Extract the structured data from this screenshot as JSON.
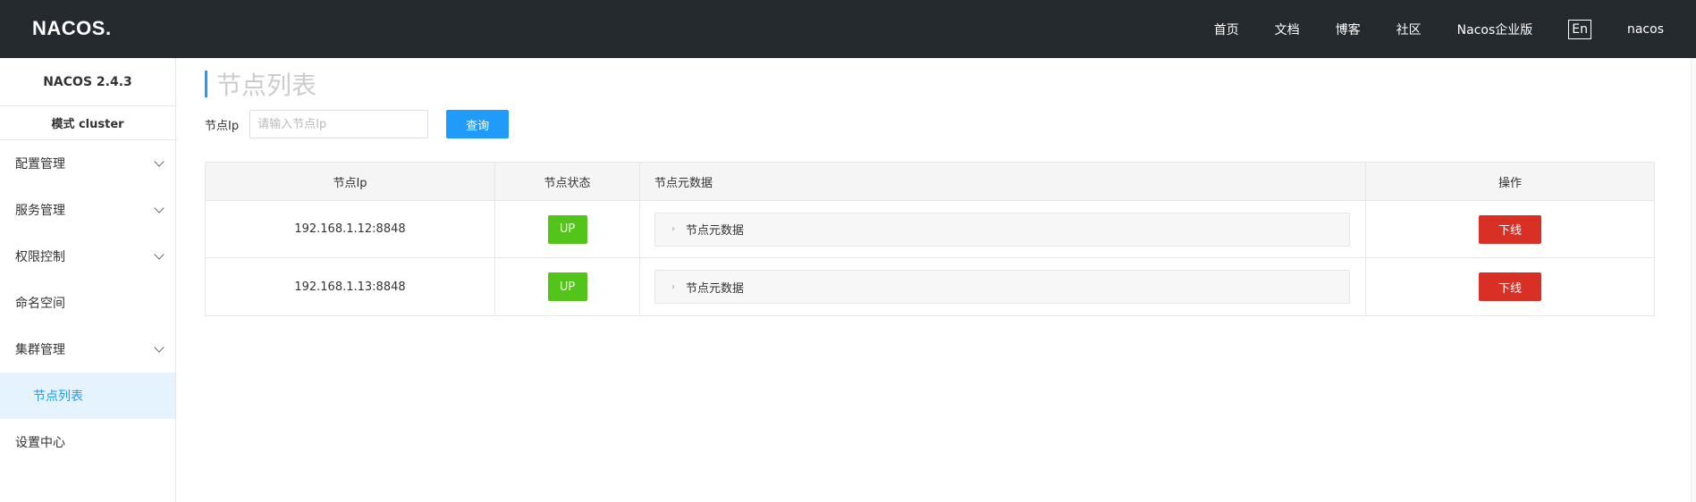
{
  "header": {
    "logo_text": "NACOS",
    "logo_dot": ".",
    "nav": [
      "首页",
      "文档",
      "博客",
      "社区",
      "Nacos企业版"
    ],
    "lang": "En",
    "user": "nacos"
  },
  "sidebar": {
    "version": "NACOS 2.4.3",
    "mode": "模式 cluster",
    "items": [
      {
        "label": "配置管理"
      },
      {
        "label": "服务管理"
      },
      {
        "label": "权限控制"
      },
      {
        "label": "命名空间"
      },
      {
        "label": "集群管理"
      }
    ],
    "sub_item": "节点列表",
    "last_item": "设置中心"
  },
  "main": {
    "title": "节点列表",
    "search": {
      "label": "节点Ip",
      "placeholder": "请输入节点Ip",
      "button": "查询"
    },
    "table": {
      "columns": [
        "节点Ip",
        "节点状态",
        "节点元数据",
        "操作"
      ],
      "rows": [
        {
          "ip": "192.168.1.12:8848",
          "status": "UP",
          "meta": "节点元数据",
          "action": "下线"
        },
        {
          "ip": "192.168.1.13:8848",
          "status": "UP",
          "meta": "节点元数据",
          "action": "下线"
        }
      ]
    }
  },
  "colors": {
    "header_bg": "#252a2f",
    "primary": "#209bfa",
    "up_badge": "#52c41a",
    "danger": "#d93026"
  }
}
